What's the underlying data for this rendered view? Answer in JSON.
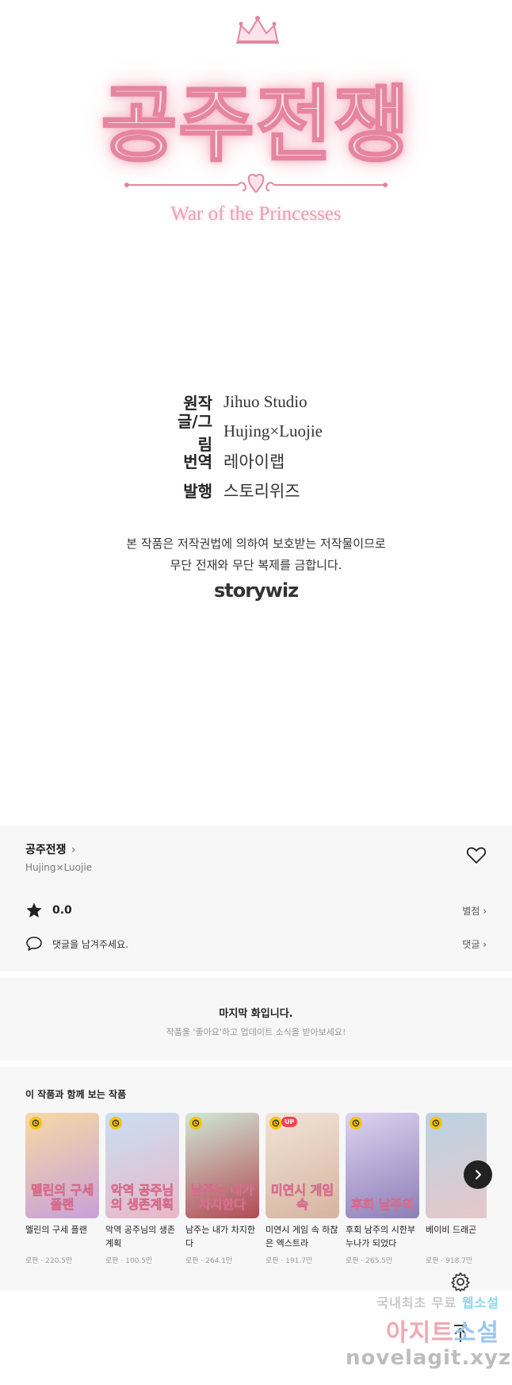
{
  "artwork": {
    "title_korean": "공주전쟁",
    "title_english": "War of the Princesses"
  },
  "credits": [
    {
      "label": "원작",
      "value": "Jihuo Studio"
    },
    {
      "label": "글/그림",
      "value": "Hujing×Luojie"
    },
    {
      "label": "번역",
      "value": "레아이랩"
    },
    {
      "label": "발행",
      "value": "스토리위즈"
    }
  ],
  "copyright": {
    "line1": "본 작품은 저작권법에 의하여 보호받는 저작물이므로",
    "line2": "무단 전재와 무단 복제를 금합니다."
  },
  "publisher_logo": "storywiz",
  "series": {
    "title": "공주전쟁",
    "author": "Hujing×Luojie",
    "rating": "0.0",
    "rating_link": "별점",
    "comment_prompt": "댓글을 남겨주세요.",
    "comment_link": "댓글"
  },
  "last_episode": {
    "title": "마지막 화입니다.",
    "subtitle": "작품을 '좋아요'하고 업데이트 소식을 받아보세요!"
  },
  "recommendations": {
    "heading": "이 작품과 함께 보는 작품",
    "items": [
      {
        "title": "멜린의 구세 플랜",
        "genre": "로판",
        "views": "220.5만",
        "badge_up": false,
        "overlay": "멜린의 구세플랜",
        "c1": "#f6d9a5",
        "c2": "#c9a0d8"
      },
      {
        "title": "악역 공주님의 생존계획",
        "genre": "로판",
        "views": "100.5만",
        "badge_up": false,
        "overlay": "악역 공주님의 생존계획",
        "c1": "#c7e0f2",
        "c2": "#e9b7c8"
      },
      {
        "title": "남주는 내가 차지한다",
        "genre": "로판",
        "views": "264.1만",
        "badge_up": false,
        "overlay": "남주는 내가 차지한다",
        "c1": "#cfe8d5",
        "c2": "#b24a55"
      },
      {
        "title": "미연시 게임 속 하찮은 엑스트라",
        "genre": "로판",
        "views": "191.7만",
        "badge_up": true,
        "overlay": "미연시 게임 속",
        "c1": "#f1e4d7",
        "c2": "#d6b4a0"
      },
      {
        "title": "후회 남주의 시한부 누나가 되었다",
        "genre": "로판",
        "views": "265.5만",
        "badge_up": false,
        "overlay": "후회 남주의",
        "c1": "#ddd3ef",
        "c2": "#8d7fb8"
      },
      {
        "title": "베이비 드래곤",
        "genre": "로판",
        "views": "918.7만",
        "badge_up": false,
        "overlay": "",
        "c1": "#b9d3e3",
        "c2": "#e8c7c9"
      }
    ]
  },
  "watermark": {
    "line1_a": "국내최초 무료 ",
    "line1_b": "웹소설",
    "line2_a": "아지트",
    "line2_b": "소설",
    "line3": "novelagit.xyz"
  },
  "colors": {
    "section_bg": "#f7f7f7",
    "badge_yellow": "#f2c413",
    "up_red": "#f0424f",
    "title_pink": "#e6859f"
  }
}
